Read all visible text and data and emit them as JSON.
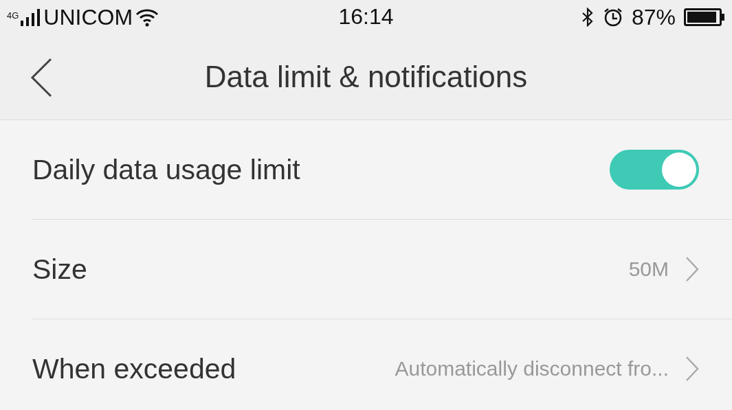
{
  "status_bar": {
    "network": "4G",
    "carrier": "UNICOM",
    "time": "16:14",
    "battery": "87%"
  },
  "header": {
    "title": "Data limit & notifications"
  },
  "rows": [
    {
      "kind": "toggle",
      "label": "Daily data usage limit",
      "on": true
    },
    {
      "kind": "value",
      "label": "Size",
      "value": "50M"
    },
    {
      "kind": "value",
      "label": "When exceeded",
      "value": "Automatically disconnect fro..."
    }
  ]
}
